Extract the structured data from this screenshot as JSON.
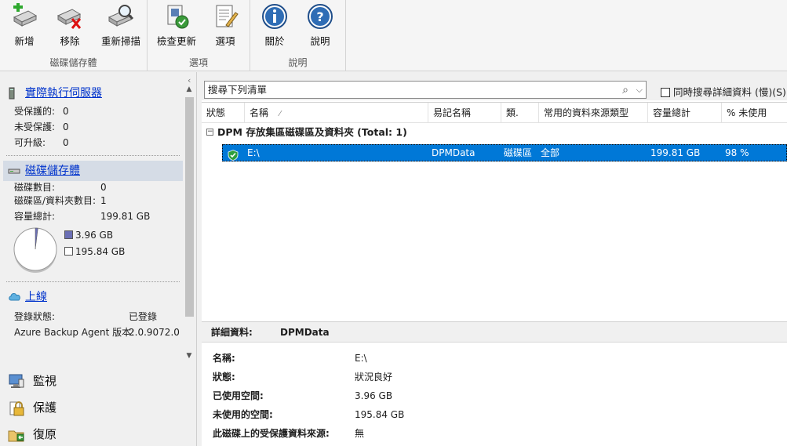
{
  "ribbon": {
    "groups": [
      {
        "label": "磁碟儲存體",
        "buttons": [
          {
            "label": "新增",
            "icon": "disk-add-icon"
          },
          {
            "label": "移除",
            "icon": "disk-remove-icon"
          },
          {
            "label": "重新掃描",
            "icon": "disk-rescan-icon"
          }
        ]
      },
      {
        "label": "選項",
        "buttons": [
          {
            "label": "檢查更新",
            "icon": "check-updates-icon"
          },
          {
            "label": "選項",
            "icon": "options-icon"
          }
        ]
      },
      {
        "label": "說明",
        "buttons": [
          {
            "label": "關於",
            "icon": "info-icon"
          },
          {
            "label": "說明",
            "icon": "help-icon"
          }
        ]
      }
    ]
  },
  "sidebar": {
    "server_section": {
      "title": "實際執行伺服器",
      "rows": [
        {
          "key": "受保護的:",
          "value": "0"
        },
        {
          "key": "未受保護:",
          "value": "0"
        },
        {
          "key": "可升級:",
          "value": "0"
        }
      ]
    },
    "disk_section": {
      "title": "磁碟儲存體",
      "rows": [
        {
          "key": "磁碟數目:",
          "value": "0"
        },
        {
          "key": "磁碟區/資料夾數目:",
          "value": "1"
        },
        {
          "key": "容量總計:",
          "value": "199.81 GB"
        }
      ],
      "legend": [
        {
          "label": "3.96 GB",
          "color": "#6b6fb5",
          "fraction": 0.0198
        },
        {
          "label": "195.84 GB",
          "color": "#ffffff",
          "fraction": 0.9802
        }
      ]
    },
    "online_section": {
      "title": "上線",
      "rows": [
        {
          "key": "登錄狀態:",
          "value": "已登錄"
        },
        {
          "key": "Azure Backup Agent 版本:",
          "value": "2.0.9072.0"
        }
      ]
    },
    "nav": [
      {
        "label": "監視",
        "icon": "monitor-icon"
      },
      {
        "label": "保護",
        "icon": "protection-lock-icon"
      },
      {
        "label": "復原",
        "icon": "recovery-folder-icon"
      }
    ]
  },
  "search": {
    "placeholder": "搜尋下列清單",
    "detail_checkbox_label": "同時搜尋詳細資料 (慢)(S)",
    "detail_checked": false
  },
  "table": {
    "columns": [
      "狀態",
      "名稱",
      "易記名稱",
      "類.",
      "常用的資料來源類型",
      "容量總計",
      "% 未使用"
    ],
    "group_label": "DPM 存放集區磁碟區及資料夾 (Total: 1)",
    "rows": [
      {
        "status": "ok",
        "name": "E:\\",
        "friendly": "DPMData",
        "type": "磁碟區",
        "source_type": "全部",
        "capacity": "199.81 GB",
        "unused": "98 %"
      }
    ]
  },
  "details": {
    "header_label": "詳細資料:",
    "header_value": "DPMData",
    "rows": [
      {
        "key": "名稱:",
        "value": "E:\\"
      },
      {
        "key": "狀態:",
        "value": "狀況良好"
      },
      {
        "key": "已使用空間:",
        "value": "3.96 GB"
      },
      {
        "key": "未使用的空間:",
        "value": "195.84 GB"
      },
      {
        "key": "此磁碟上的受保護資料來源:",
        "value": "無"
      }
    ]
  }
}
